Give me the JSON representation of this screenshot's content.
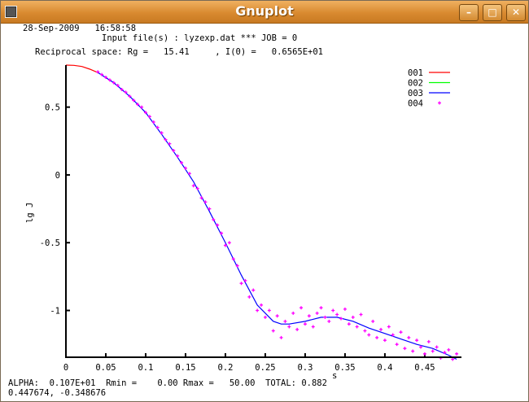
{
  "window": {
    "title": "Gnuplot",
    "buttons": {
      "minimize": "–",
      "maximize": "□",
      "close": "✕"
    }
  },
  "header": {
    "datetime": "28-Sep-2009   16:58:58",
    "input_line": "Input file(s) : lyzexp.dat *** JOB = 0",
    "reciprocal_line": "Reciprocal space: Rg =   15.41     , I(0) =   0.6565E+01"
  },
  "footer": {
    "stats_line": "ALPHA:  0.107E+01  Rmin =    0.00 Rmax =   50.00  TOTAL: 0.882",
    "cursor_readout": "0.447674, -0.348676"
  },
  "colors": {
    "c001": "#ff0000",
    "c002": "#00ff00",
    "c003": "#0000ff",
    "c004": "#ff00ff"
  },
  "chart_data": {
    "type": "line",
    "xlabel": "s",
    "ylabel": "lg J",
    "xlim": [
      0,
      0.495
    ],
    "ylim": [
      -1.345,
      0.81
    ],
    "xticks": [
      "0",
      "0.05",
      "0.1",
      "0.15",
      "0.2",
      "0.25",
      "0.3",
      "0.35",
      "0.4",
      "0.45"
    ],
    "xtick_values": [
      0,
      0.05,
      0.1,
      0.15,
      0.2,
      0.25,
      0.3,
      0.35,
      0.4,
      0.45
    ],
    "yticks": [
      "0.5",
      "0",
      "-0.5",
      "-1"
    ],
    "ytick_values": [
      0.5,
      0,
      -0.5,
      -1
    ],
    "legend": {
      "placement": "top-right",
      "entries": [
        "001",
        "002",
        "003",
        "004"
      ]
    },
    "series": [
      {
        "name": "001",
        "style": "line",
        "x": [
          0,
          0.01,
          0.02,
          0.03,
          0.04
        ],
        "y": [
          0.81,
          0.808,
          0.8,
          0.78,
          0.755
        ]
      },
      {
        "name": "002",
        "style": "line",
        "x": [],
        "y": []
      },
      {
        "name": "003",
        "style": "line",
        "x": [
          0.04,
          0.06,
          0.08,
          0.1,
          0.12,
          0.14,
          0.16,
          0.18,
          0.2,
          0.22,
          0.24,
          0.26,
          0.27,
          0.28,
          0.3,
          0.32,
          0.34,
          0.36,
          0.38,
          0.4,
          0.42,
          0.44,
          0.46,
          0.48,
          0.49
        ],
        "y": [
          0.755,
          0.68,
          0.58,
          0.46,
          0.3,
          0.13,
          -0.05,
          -0.27,
          -0.5,
          -0.74,
          -0.96,
          -1.08,
          -1.1,
          -1.1,
          -1.08,
          -1.05,
          -1.05,
          -1.08,
          -1.13,
          -1.17,
          -1.21,
          -1.25,
          -1.28,
          -1.33,
          -1.36
        ]
      },
      {
        "name": "004",
        "style": "points",
        "x": [
          0.04,
          0.045,
          0.05,
          0.055,
          0.06,
          0.065,
          0.07,
          0.075,
          0.08,
          0.085,
          0.09,
          0.095,
          0.1,
          0.105,
          0.11,
          0.115,
          0.12,
          0.125,
          0.13,
          0.135,
          0.14,
          0.145,
          0.15,
          0.155,
          0.16,
          0.165,
          0.17,
          0.175,
          0.18,
          0.185,
          0.19,
          0.195,
          0.2,
          0.205,
          0.21,
          0.215,
          0.22,
          0.225,
          0.23,
          0.235,
          0.24,
          0.245,
          0.25,
          0.255,
          0.26,
          0.265,
          0.27,
          0.275,
          0.28,
          0.285,
          0.29,
          0.295,
          0.3,
          0.305,
          0.31,
          0.315,
          0.32,
          0.325,
          0.33,
          0.335,
          0.34,
          0.345,
          0.35,
          0.355,
          0.36,
          0.365,
          0.37,
          0.375,
          0.38,
          0.385,
          0.39,
          0.395,
          0.4,
          0.405,
          0.41,
          0.415,
          0.42,
          0.425,
          0.43,
          0.435,
          0.44,
          0.445,
          0.45,
          0.455,
          0.46,
          0.465,
          0.47,
          0.475,
          0.48,
          0.485,
          0.49
        ],
        "y": [
          0.76,
          0.74,
          0.72,
          0.7,
          0.68,
          0.66,
          0.63,
          0.61,
          0.58,
          0.55,
          0.52,
          0.5,
          0.46,
          0.43,
          0.39,
          0.35,
          0.31,
          0.26,
          0.23,
          0.18,
          0.14,
          0.09,
          0.05,
          0.01,
          -0.08,
          -0.1,
          -0.17,
          -0.2,
          -0.25,
          -0.33,
          -0.37,
          -0.43,
          -0.52,
          -0.5,
          -0.62,
          -0.67,
          -0.8,
          -0.78,
          -0.9,
          -0.85,
          -1.0,
          -0.96,
          -1.05,
          -1.0,
          -1.15,
          -1.04,
          -1.2,
          -1.08,
          -1.12,
          -1.02,
          -1.14,
          -0.98,
          -1.1,
          -1.04,
          -1.12,
          -1.02,
          -0.98,
          -1.05,
          -1.08,
          -1.0,
          -1.03,
          -1.06,
          -0.99,
          -1.1,
          -1.05,
          -1.12,
          -1.03,
          -1.15,
          -1.18,
          -1.08,
          -1.2,
          -1.14,
          -1.22,
          -1.12,
          -1.18,
          -1.25,
          -1.16,
          -1.28,
          -1.2,
          -1.3,
          -1.22,
          -1.27,
          -1.32,
          -1.23,
          -1.3,
          -1.27,
          -1.35,
          -1.31,
          -1.29,
          -1.36,
          -1.32
        ]
      }
    ]
  }
}
